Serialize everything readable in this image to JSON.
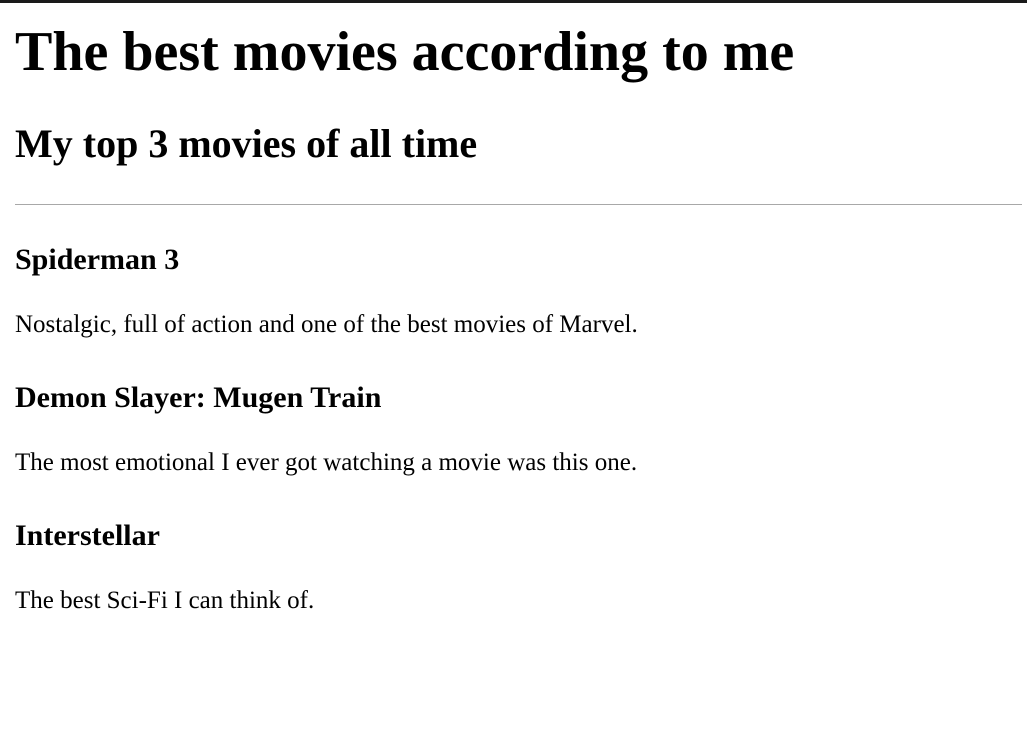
{
  "header": {
    "title": "The best movies according to me",
    "subtitle": "My top 3 movies of all time"
  },
  "movies": [
    {
      "title": "Spiderman 3",
      "description": "Nostalgic, full of action and one of the best movies of Marvel."
    },
    {
      "title": "Demon Slayer: Mugen Train",
      "description": "The most emotional I ever got watching a movie was this one."
    },
    {
      "title": "Interstellar",
      "description": "The best Sci-Fi I can think of."
    }
  ]
}
